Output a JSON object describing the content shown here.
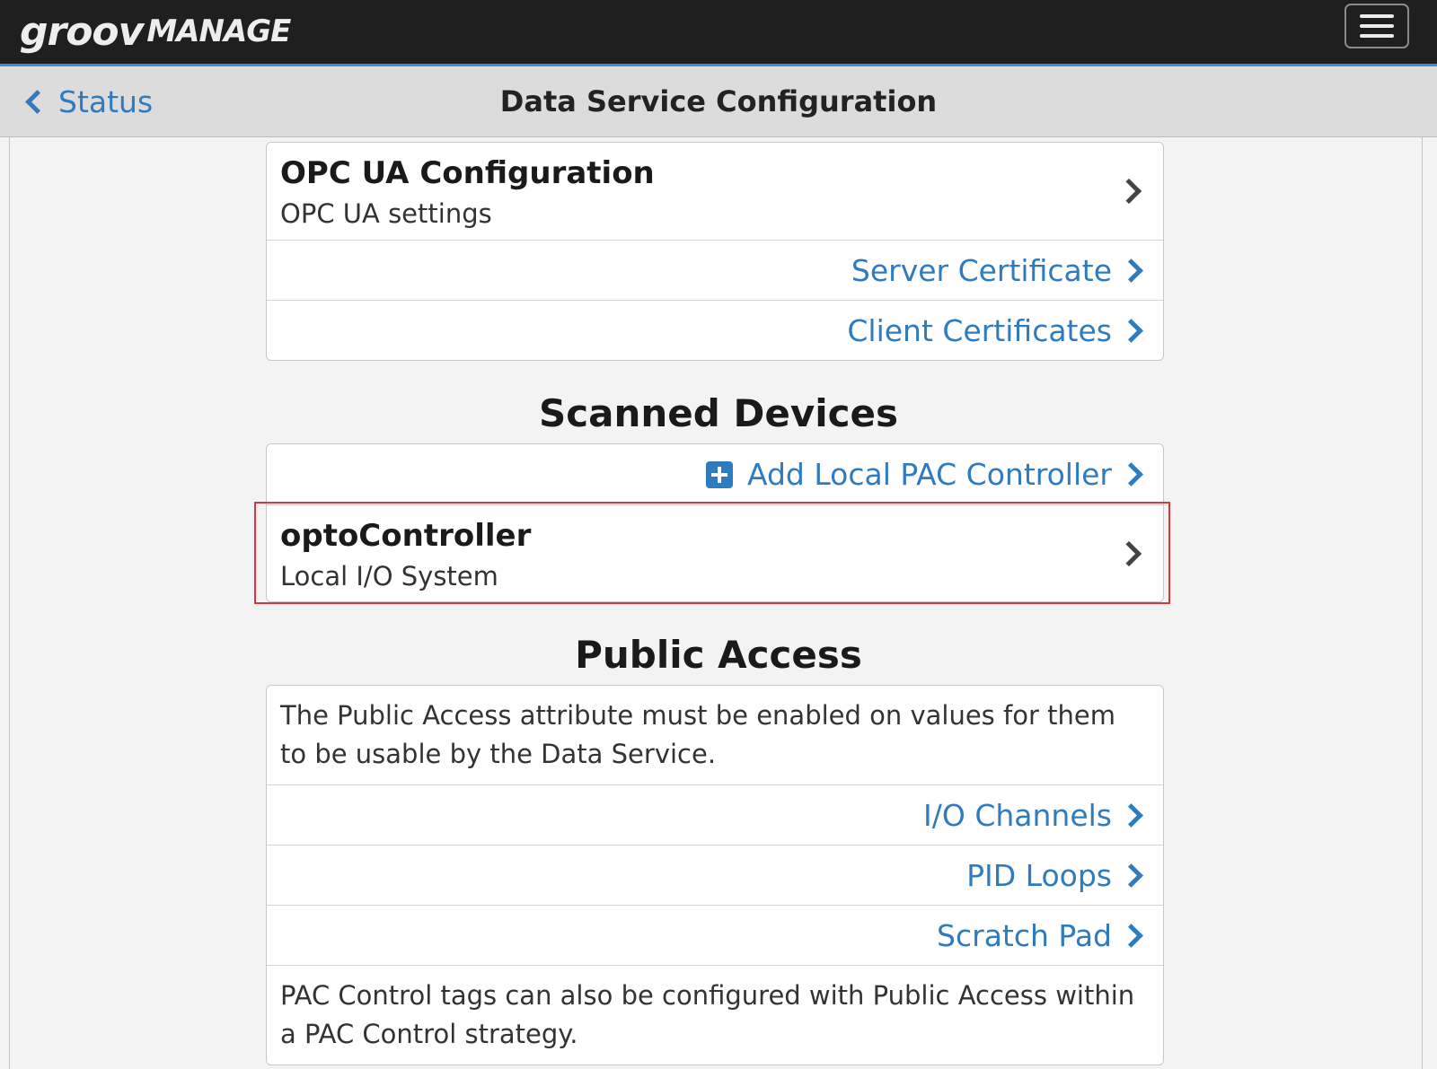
{
  "header": {
    "logo_groov": "groov",
    "logo_manage": "MANAGE"
  },
  "subheader": {
    "back_label": "Status",
    "title": "Data Service Configuration"
  },
  "opcua": {
    "title": "OPC UA Configuration",
    "subtitle": "OPC UA settings",
    "links": [
      "Server Certificate",
      "Client Certificates"
    ]
  },
  "scanned_devices": {
    "heading": "Scanned Devices",
    "add_label": "Add Local PAC Controller",
    "device": {
      "name": "optoController",
      "type": "Local I/O System"
    }
  },
  "public_access": {
    "heading": "Public Access",
    "note": "The Public Access attribute must be enabled on values for them to be usable by the Data Service.",
    "links": [
      "I/O Channels",
      "PID Loops",
      "Scratch Pad"
    ],
    "footer_note": "PAC Control tags can also be configured with Public Access within a PAC Control strategy."
  },
  "colors": {
    "accent": "#2f7bbf",
    "topbar": "#1f1f1f",
    "highlight": "#d9363e"
  }
}
